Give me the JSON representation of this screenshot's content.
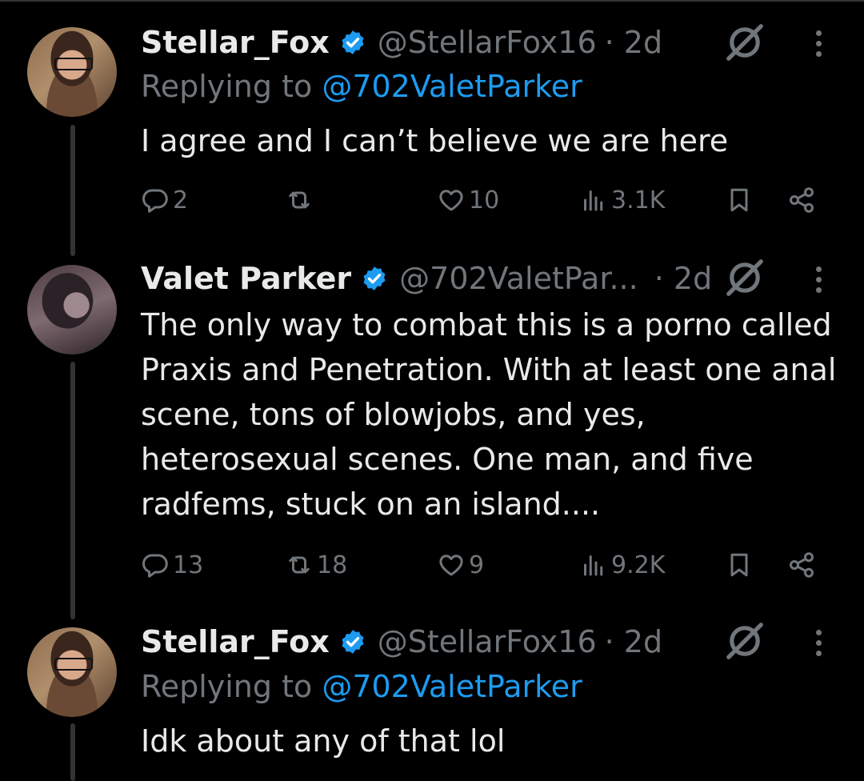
{
  "tweets": [
    {
      "name": "Stellar_Fox",
      "handle": "@StellarFox16",
      "time": "· 2d",
      "reply_prefix": "Replying to ",
      "reply_to": "@702ValetParker",
      "text": "I agree and I can’t believe we are here",
      "replies": "2",
      "reposts": "",
      "likes": "10",
      "views": "3.1K"
    },
    {
      "name": "Valet Parker",
      "handle": "@702ValetPar...",
      "time": "· 2d",
      "text": "The only way to combat this is a porno called Praxis and Penetration. With at least one anal scene, tons of blowjobs, and yes, heterosexual scenes. One man, and five radfems, stuck on an island....",
      "replies": "13",
      "reposts": "18",
      "likes": "9",
      "views": "9.2K"
    },
    {
      "name": "Stellar_Fox",
      "handle": "@StellarFox16",
      "time": "· 2d",
      "reply_prefix": "Replying to ",
      "reply_to": "@702ValetParker",
      "text": "Idk about any of that lol"
    }
  ],
  "colors": {
    "accent": "#1d9bf0",
    "muted": "#71767b",
    "text": "#e7e9ea",
    "background": "#000000"
  },
  "icons": [
    "verified-badge-icon",
    "grok-icon",
    "more-icon",
    "reply-icon",
    "repost-icon",
    "like-icon",
    "views-icon",
    "bookmark-icon",
    "share-icon"
  ]
}
